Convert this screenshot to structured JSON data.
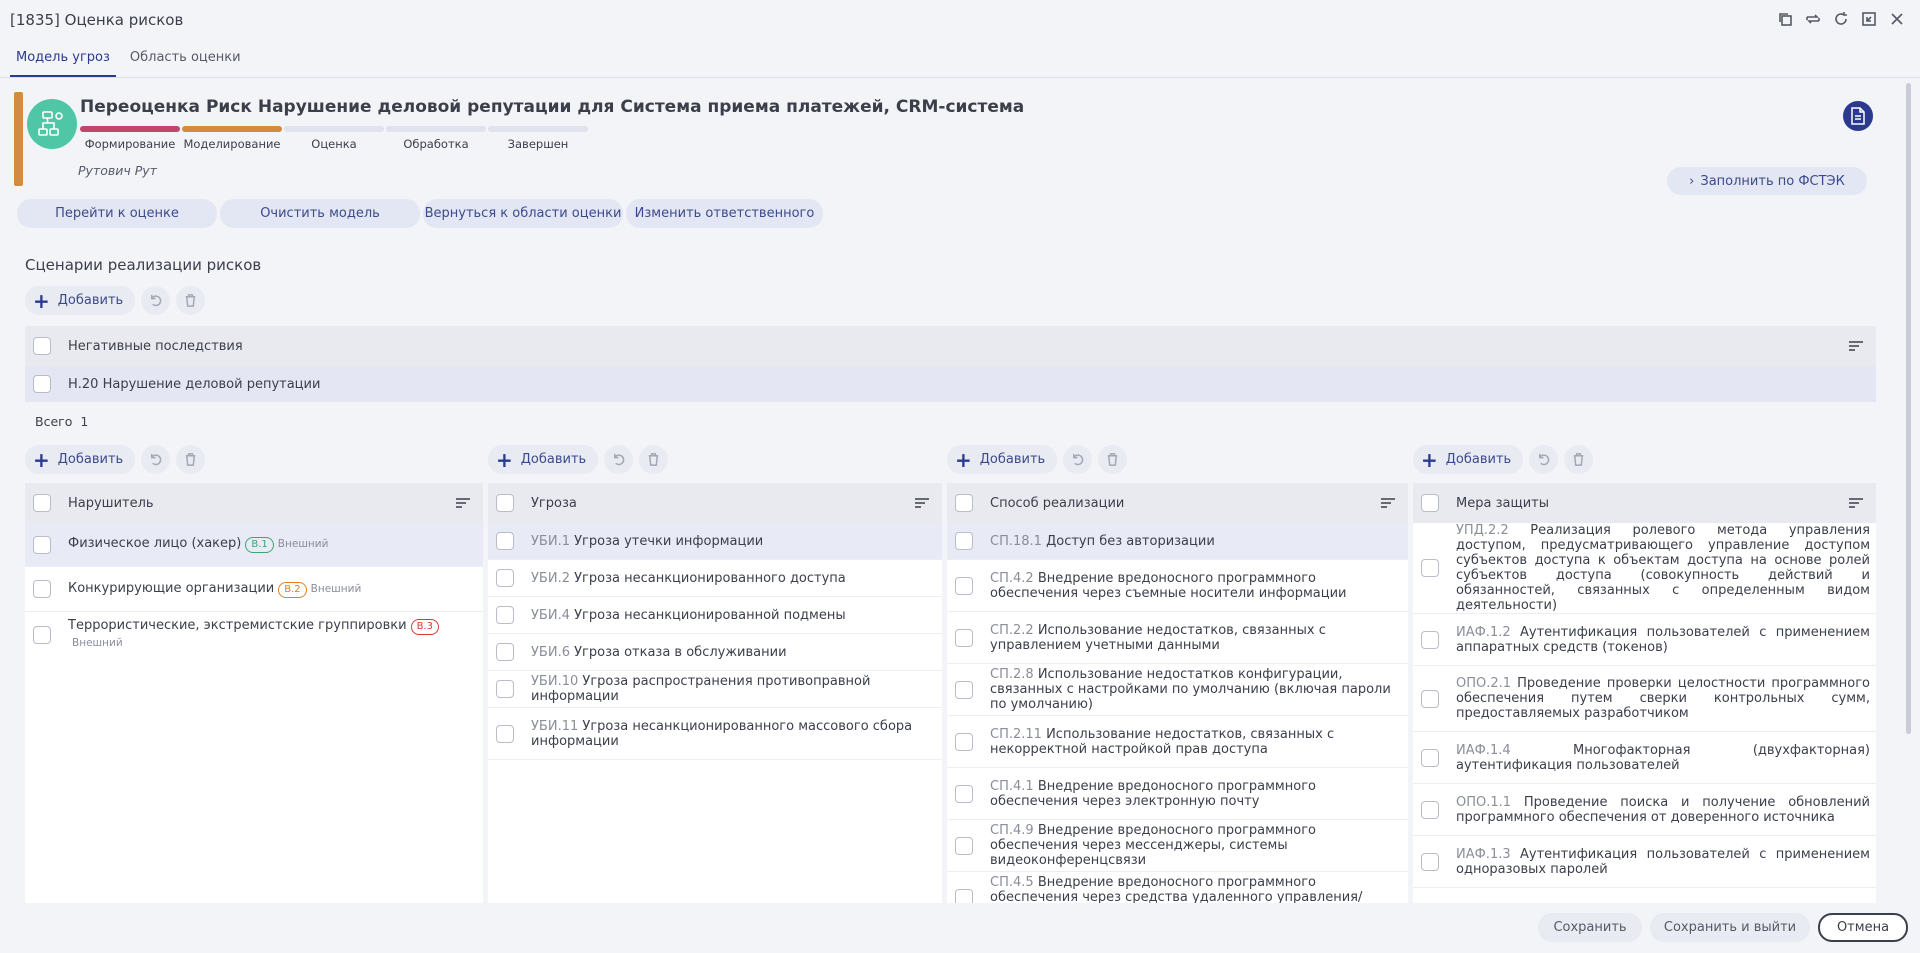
{
  "window": {
    "title": "[1835] Оценка рисков"
  },
  "tabs": [
    {
      "label": "Модель угроз",
      "active": true
    },
    {
      "label": "Область оценки",
      "active": false
    }
  ],
  "header": {
    "title": "Переоценка Риск Нарушение деловой репутации для Система приема платежей, CRM-система",
    "owner": "Рутович Рут",
    "stages": [
      {
        "label": "Формирование",
        "color": "#c2466a"
      },
      {
        "label": "Моделирование",
        "color": "#d68a3e"
      },
      {
        "label": "Оценка",
        "color": "#e0e2ec"
      },
      {
        "label": "Обработка",
        "color": "#e0e2ec"
      },
      {
        "label": "Завершен",
        "color": "#e0e2ec"
      }
    ],
    "fstek_label": "Заполнить по ФСТЭК"
  },
  "actions": {
    "goto_assessment": "Перейти к оценке",
    "clear_model": "Очистить модель",
    "back_to_scope": "Вернуться к области оценки",
    "change_owner": "Изменить ответственного"
  },
  "section_title": "Сценарии реализации рисков",
  "add_label": "Добавить",
  "negative": {
    "header": "Негативные последствия",
    "rows": [
      {
        "code": "Н.20",
        "text": "Нарушение деловой репутации"
      }
    ],
    "total_label": "Всего",
    "total_value": "1"
  },
  "intruder": {
    "header": "Нарушитель",
    "rows": [
      {
        "text": "Физическое лицо (хакер)",
        "badge": "В.1",
        "badge_color": "#3aa76d",
        "type": "Внешний"
      },
      {
        "text": "Конкурирующие организации",
        "badge": "В.2",
        "badge_color": "#e07f22",
        "type": "Внешний"
      },
      {
        "text": "Террористические, экстремистские группировки",
        "badge": "В.3",
        "badge_color": "#d63a3a",
        "type": "Внешний"
      }
    ]
  },
  "threat": {
    "header": "Угроза",
    "rows": [
      {
        "code": "УБИ.1",
        "text": "Угроза утечки информации"
      },
      {
        "code": "УБИ.2",
        "text": "Угроза несанкционированного доступа"
      },
      {
        "code": "УБИ.4",
        "text": "Угроза несанкционированной подмены"
      },
      {
        "code": "УБИ.6",
        "text": "Угроза отказа в обслуживании"
      },
      {
        "code": "УБИ.10",
        "text": "Угроза распространения противоправной информации"
      },
      {
        "code": "УБИ.11",
        "text": "Угроза несанкционированного массового сбора информации"
      }
    ]
  },
  "method": {
    "header": "Способ реализации",
    "rows": [
      {
        "code": "СП.18.1",
        "text": "Доступ без авторизации"
      },
      {
        "code": "СП.4.2",
        "text": "Внедрение вредоносного программного обеспечения через съемные носители информации"
      },
      {
        "code": "СП.2.2",
        "text": "Использование недостатков, связанных с управлением учетными данными"
      },
      {
        "code": "СП.2.8",
        "text": "Использование недостатков конфигурации, связанных с настройками по умолчанию (включая пароли по умолчанию)"
      },
      {
        "code": "СП.2.11",
        "text": "Использование недостатков, связанных с некорректной настройкой прав доступа"
      },
      {
        "code": "СП.4.1",
        "text": "Внедрение вредоносного программного обеспечения через электронную почту"
      },
      {
        "code": "СП.4.9",
        "text": "Внедрение вредоносного программного обеспечения через мессенджеры, системы видеоконференцсвязи"
      },
      {
        "code": "СП.4.5",
        "text": "Внедрение вредоносного программного обеспечения через средства удаленного управления/доступа"
      }
    ]
  },
  "measure": {
    "header": "Мера защиты",
    "rows": [
      {
        "code": "УПД.2.2",
        "text": "Реализация ролевого метода управления доступом, предусматривающего управление доступом субъектов доступа к объектам доступа на основе ролей субъектов доступа (совокупность действий и обязанностей, связанных с определенным видом деятельности)"
      },
      {
        "code": "ИАФ.1.2",
        "text": "Аутентификация пользователей с применением аппаратных средств (токенов)"
      },
      {
        "code": "ОПО.2.1",
        "text": "Проведение проверки целостности программного обеспечения путем сверки контрольных сумм, предоставляемых разработчиком"
      },
      {
        "code": "ИАФ.1.4",
        "text": "Многофакторная (двухфакторная) аутентификация пользователей"
      },
      {
        "code": "ОПО.1.1",
        "text": "Проведение поиска и получение обновлений программного обеспечения от доверенного источника"
      },
      {
        "code": "ИАФ.1.3",
        "text": "Аутентификация пользователей с применением одноразовых паролей"
      }
    ]
  },
  "footer": {
    "save": "Сохранить",
    "save_exit": "Сохранить и выйти",
    "cancel": "Отмена"
  }
}
